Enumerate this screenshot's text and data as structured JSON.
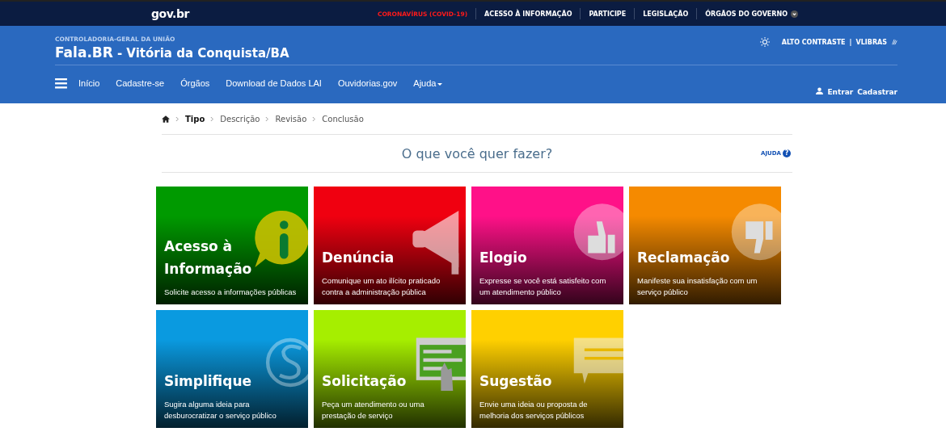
{
  "topbar": {
    "logo": "gov.br",
    "links": [
      {
        "label": "CORONAVÍRUS (COVID-19)",
        "kind": "alert"
      },
      {
        "label": "ACESSO À INFORMAÇÃO",
        "kind": "plain"
      },
      {
        "label": "PARTICIPE",
        "kind": "plain"
      },
      {
        "label": "LEGISLAÇÃO",
        "kind": "plain"
      },
      {
        "label": "ÓRGÃOS DO GOVERNO",
        "kind": "dropdown"
      }
    ]
  },
  "header": {
    "agency": "CONTROLADORIA-GERAL DA UNIÃO",
    "brand": "Fala.BR",
    "subtitle": "- Vitória da Conquista/BA",
    "contrast": "ALTO CONTRASTE",
    "separator": "|",
    "vlibras": "VLIBRAS",
    "nav": [
      {
        "label": "Início",
        "dropdown": false
      },
      {
        "label": "Cadastre-se",
        "dropdown": false
      },
      {
        "label": "Órgãos",
        "dropdown": false
      },
      {
        "label": "Download de Dados LAI",
        "dropdown": false
      },
      {
        "label": "Ouvidorias.gov",
        "dropdown": false
      },
      {
        "label": "Ajuda",
        "dropdown": true
      }
    ],
    "login": "Entrar",
    "register": "Cadastrar"
  },
  "breadcrumb": [
    {
      "label": "Tipo",
      "selected": true
    },
    {
      "label": "Descrição",
      "selected": false
    },
    {
      "label": "Revisão",
      "selected": false
    },
    {
      "label": "Conclusão",
      "selected": false
    }
  ],
  "heading": "O que você quer fazer?",
  "help": "AJUDA",
  "help_icon": "?",
  "cards": [
    {
      "title": "Acesso à Informação",
      "text": "Solicite acesso a informações públicas",
      "color": "#009a00",
      "kind": "info"
    },
    {
      "title": "Denúncia",
      "text": "Comunique um ato ilícito praticado contra a administração pública",
      "color": "#f00010",
      "kind": "megaphone"
    },
    {
      "title": "Elogio",
      "text": "Expresse se você está satisfeito com um atendimento público",
      "color": "#ff1188",
      "kind": "thumbs-up"
    },
    {
      "title": "Reclamação",
      "text": "Manifeste sua insatisfação com um serviço público",
      "color": "#f58a00",
      "kind": "thumbs-down"
    },
    {
      "title": "Simplifique",
      "text": "Sugira alguma ideia para desburocratizar o serviço público",
      "color": "#0a9ae0",
      "kind": "cycle"
    },
    {
      "title": "Solicitação",
      "text": "Peça um atendimento ou uma prestação de serviço",
      "color": "#a6ee00",
      "kind": "screen"
    },
    {
      "title": "Sugestão",
      "text": "Envie uma ideia ou proposta de melhoria dos serviços públicos",
      "color": "#ffd000",
      "kind": "chat"
    }
  ]
}
